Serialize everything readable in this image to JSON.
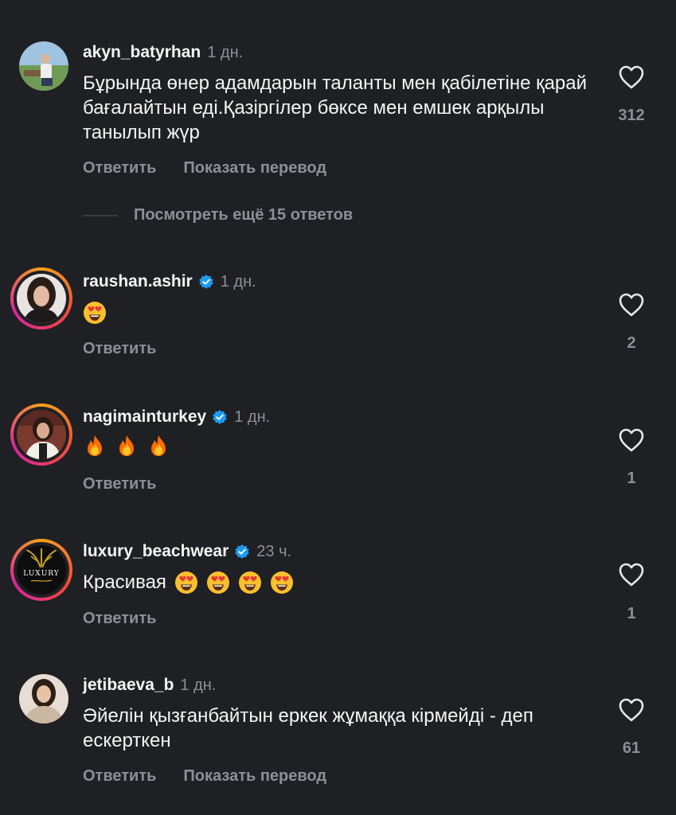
{
  "comments": [
    {
      "username": "akyn_batyrhan",
      "time": "1 дн.",
      "text": "Бұрында өнер адамдарын таланты мен қабілетіне қарай бағалайтын еді.Қазіргілер бөксе мен емшек арқылы танылып жүр",
      "reply_label": "Ответить",
      "translate_label": "Показать перевод",
      "likes": "312"
    },
    {
      "username": "raushan.ashir",
      "verified": true,
      "time": "1 дн.",
      "reply_label": "Ответить",
      "likes": "2"
    },
    {
      "username": "nagimainturkey",
      "verified": true,
      "time": "1 дн.",
      "reply_label": "Ответить",
      "likes": "1"
    },
    {
      "username": "luxury_beachwear",
      "verified": true,
      "time": "23 ч.",
      "text": "Красивая",
      "avatar_text": "LUXURY",
      "reply_label": "Ответить",
      "likes": "1"
    },
    {
      "username": "jetibaeva_b",
      "time": "1 дн.",
      "text": "Әйелін қызғанбайтын еркек жұмаққа кірмейді - деп ескерткен",
      "reply_label": "Ответить",
      "translate_label": "Показать перевод",
      "likes": "61"
    }
  ],
  "more_replies_label": "Посмотреть ещё 15 ответов",
  "icons": {
    "like": "heart-outline-icon",
    "verified": "verified-badge-icon",
    "emoji_heart_eyes": "heart-eyes-emoji",
    "emoji_fire": "fire-emoji"
  },
  "colors": {
    "background": "#1f2024",
    "primary_text": "#f5f5f5",
    "secondary_text": "#8e8f94",
    "verified_blue": "#1d9bf0"
  }
}
